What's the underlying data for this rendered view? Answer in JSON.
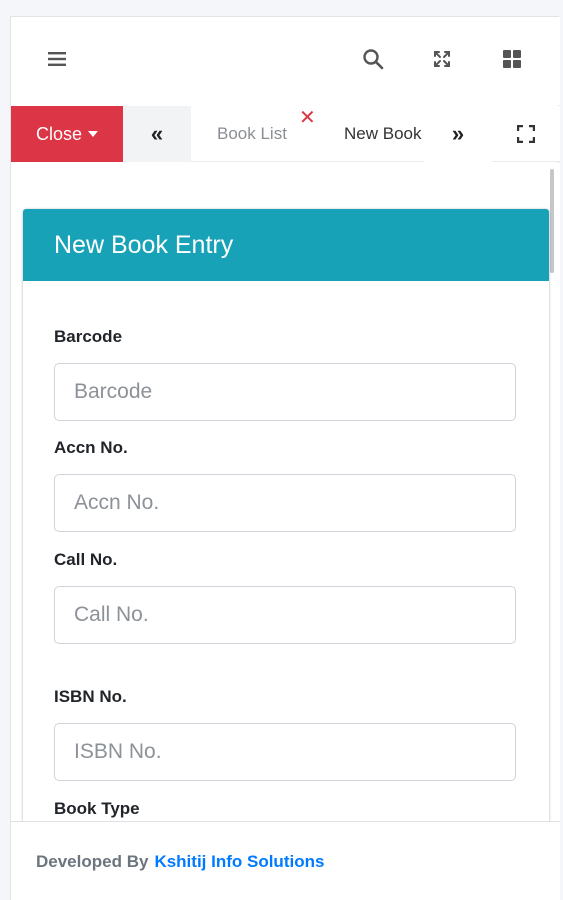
{
  "navbar": {
    "menu_icon": "hamburger-icon",
    "search_icon": "search-icon",
    "fullscreen_icon": "arrows-expand-icon",
    "apps_icon": "grid-icon"
  },
  "tabs": {
    "close_label": "Close",
    "scroll_left_label": "«",
    "scroll_right_label": "»",
    "items": [
      {
        "label": "Book List"
      },
      {
        "label": "New Book"
      }
    ],
    "tab_close_symbol": "✕"
  },
  "form": {
    "title": "New Book Entry",
    "fields": [
      {
        "label": "Barcode",
        "placeholder": "Barcode"
      },
      {
        "label": "Accn No.",
        "placeholder": "Accn No."
      },
      {
        "label": "Call No.",
        "placeholder": "Call No."
      },
      {
        "label": "ISBN No.",
        "placeholder": "ISBN No."
      },
      {
        "label": "Book Type"
      }
    ]
  },
  "footer": {
    "prefix": "Developed By",
    "company": "Kshitij Info Solutions"
  },
  "colors": {
    "close_button": "#dc3545",
    "card_header": "#17a2b8",
    "footer_link": "#007bff"
  }
}
